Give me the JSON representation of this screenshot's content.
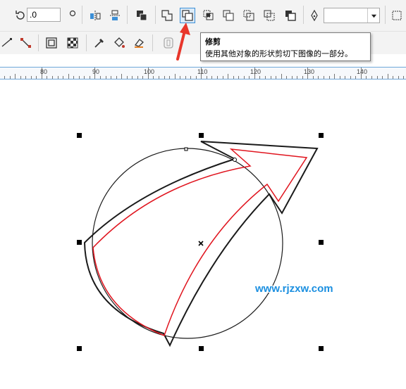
{
  "toolbar": {
    "rotation_value": ".0",
    "outline_width_value": ""
  },
  "tooltip": {
    "title": "修剪",
    "description": "使用其他对象的形状剪切下图像的一部分。"
  },
  "ruler": {
    "labels": [
      "80",
      "90",
      "100",
      "110",
      "120",
      "130",
      "140"
    ]
  },
  "watermark": "www.rjzxw.com",
  "colors": {
    "accent": "#3c8fd6",
    "arrow_pointer": "#e8362b",
    "selected_outline": "#e0141e",
    "watermark": "#1b8fe0"
  },
  "icons": {
    "rotate": "rotate-icon",
    "trim": "trim-icon",
    "pen": "pen-nib-icon"
  }
}
